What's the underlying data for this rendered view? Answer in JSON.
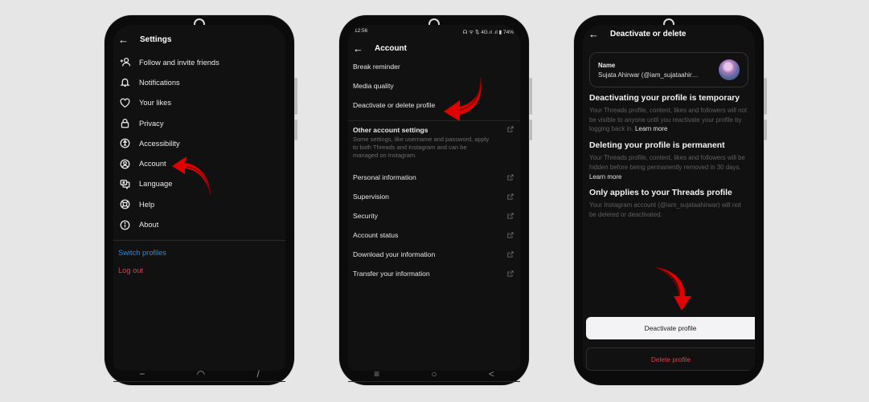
{
  "colors": {
    "background": "#e6e6e6",
    "phone_frame": "#0b0b0b",
    "screen": "#111111",
    "accent_blue": "#1f8fe5",
    "danger_red": "#e23d4b",
    "arrow_red": "#e10000"
  },
  "phone1": {
    "header": {
      "back_icon": "arrow-left-icon",
      "title": "Settings"
    },
    "menu": [
      {
        "label": "Follow and invite friends",
        "icon": "add-person-icon"
      },
      {
        "label": "Notifications",
        "icon": "bell-icon"
      },
      {
        "label": "Your likes",
        "icon": "heart-icon"
      },
      {
        "label": "Privacy",
        "icon": "lock-icon"
      },
      {
        "label": "Accessibility",
        "icon": "accessibility-icon"
      },
      {
        "label": "Account",
        "icon": "account-circle-icon"
      },
      {
        "label": "Language",
        "icon": "language-icon"
      },
      {
        "label": "Help",
        "icon": "lifebuoy-icon"
      },
      {
        "label": "About",
        "icon": "info-icon"
      }
    ],
    "switch_profiles": "Switch profiles",
    "log_out": "Log out",
    "nav": {
      "recents": "recents-icon",
      "home": "home-icon",
      "back": "back-icon"
    }
  },
  "phone2": {
    "status_bar": {
      "time": "12:56",
      "icons": "headphones wifi-call data 4G signal signal battery",
      "battery": "74%"
    },
    "header": {
      "back_icon": "arrow-left-icon",
      "title": "Account"
    },
    "items": [
      {
        "label": "Break reminder",
        "external": false
      },
      {
        "label": "Media quality",
        "external": false
      },
      {
        "label": "Deactivate or delete profile",
        "external": false
      }
    ],
    "other_settings": {
      "title": "Other account settings",
      "description": "Some settings, like username and password, apply to both Threads and Instagram and can be managed on Instagram."
    },
    "external_items": [
      {
        "label": "Personal information"
      },
      {
        "label": "Supervision"
      },
      {
        "label": "Security"
      },
      {
        "label": "Account status"
      },
      {
        "label": "Download your information"
      },
      {
        "label": "Transfer your information"
      }
    ],
    "nav": {
      "recents_glyph": "≡",
      "home_glyph": "○",
      "back_glyph": "<"
    }
  },
  "phone3": {
    "header": {
      "back_icon": "arrow-left-icon",
      "title": "Deactivate or delete"
    },
    "name_card": {
      "label": "Name",
      "value": "Sujata Ahirwar (@iam_sujataahir…"
    },
    "sections": [
      {
        "title": "Deactivating your profile is temporary",
        "body": "Your Threads profile, content, likes and followers will not be visible to anyone until you reactivate your profile by logging back in.",
        "link": "Learn more"
      },
      {
        "title": "Deleting your profile is permanent",
        "body": "Your Threads profile, content, likes and followers will be hidden before being permanently removed in 30 days.",
        "link": "Learn more"
      },
      {
        "title": "Only applies to your Threads profile",
        "body": "Your Instagram account (@iam_sujataahirwar) will not be deleted or deactivated.",
        "link": ""
      }
    ],
    "deactivate_button": "Deactivate profile",
    "delete_button": "Delete profile"
  }
}
